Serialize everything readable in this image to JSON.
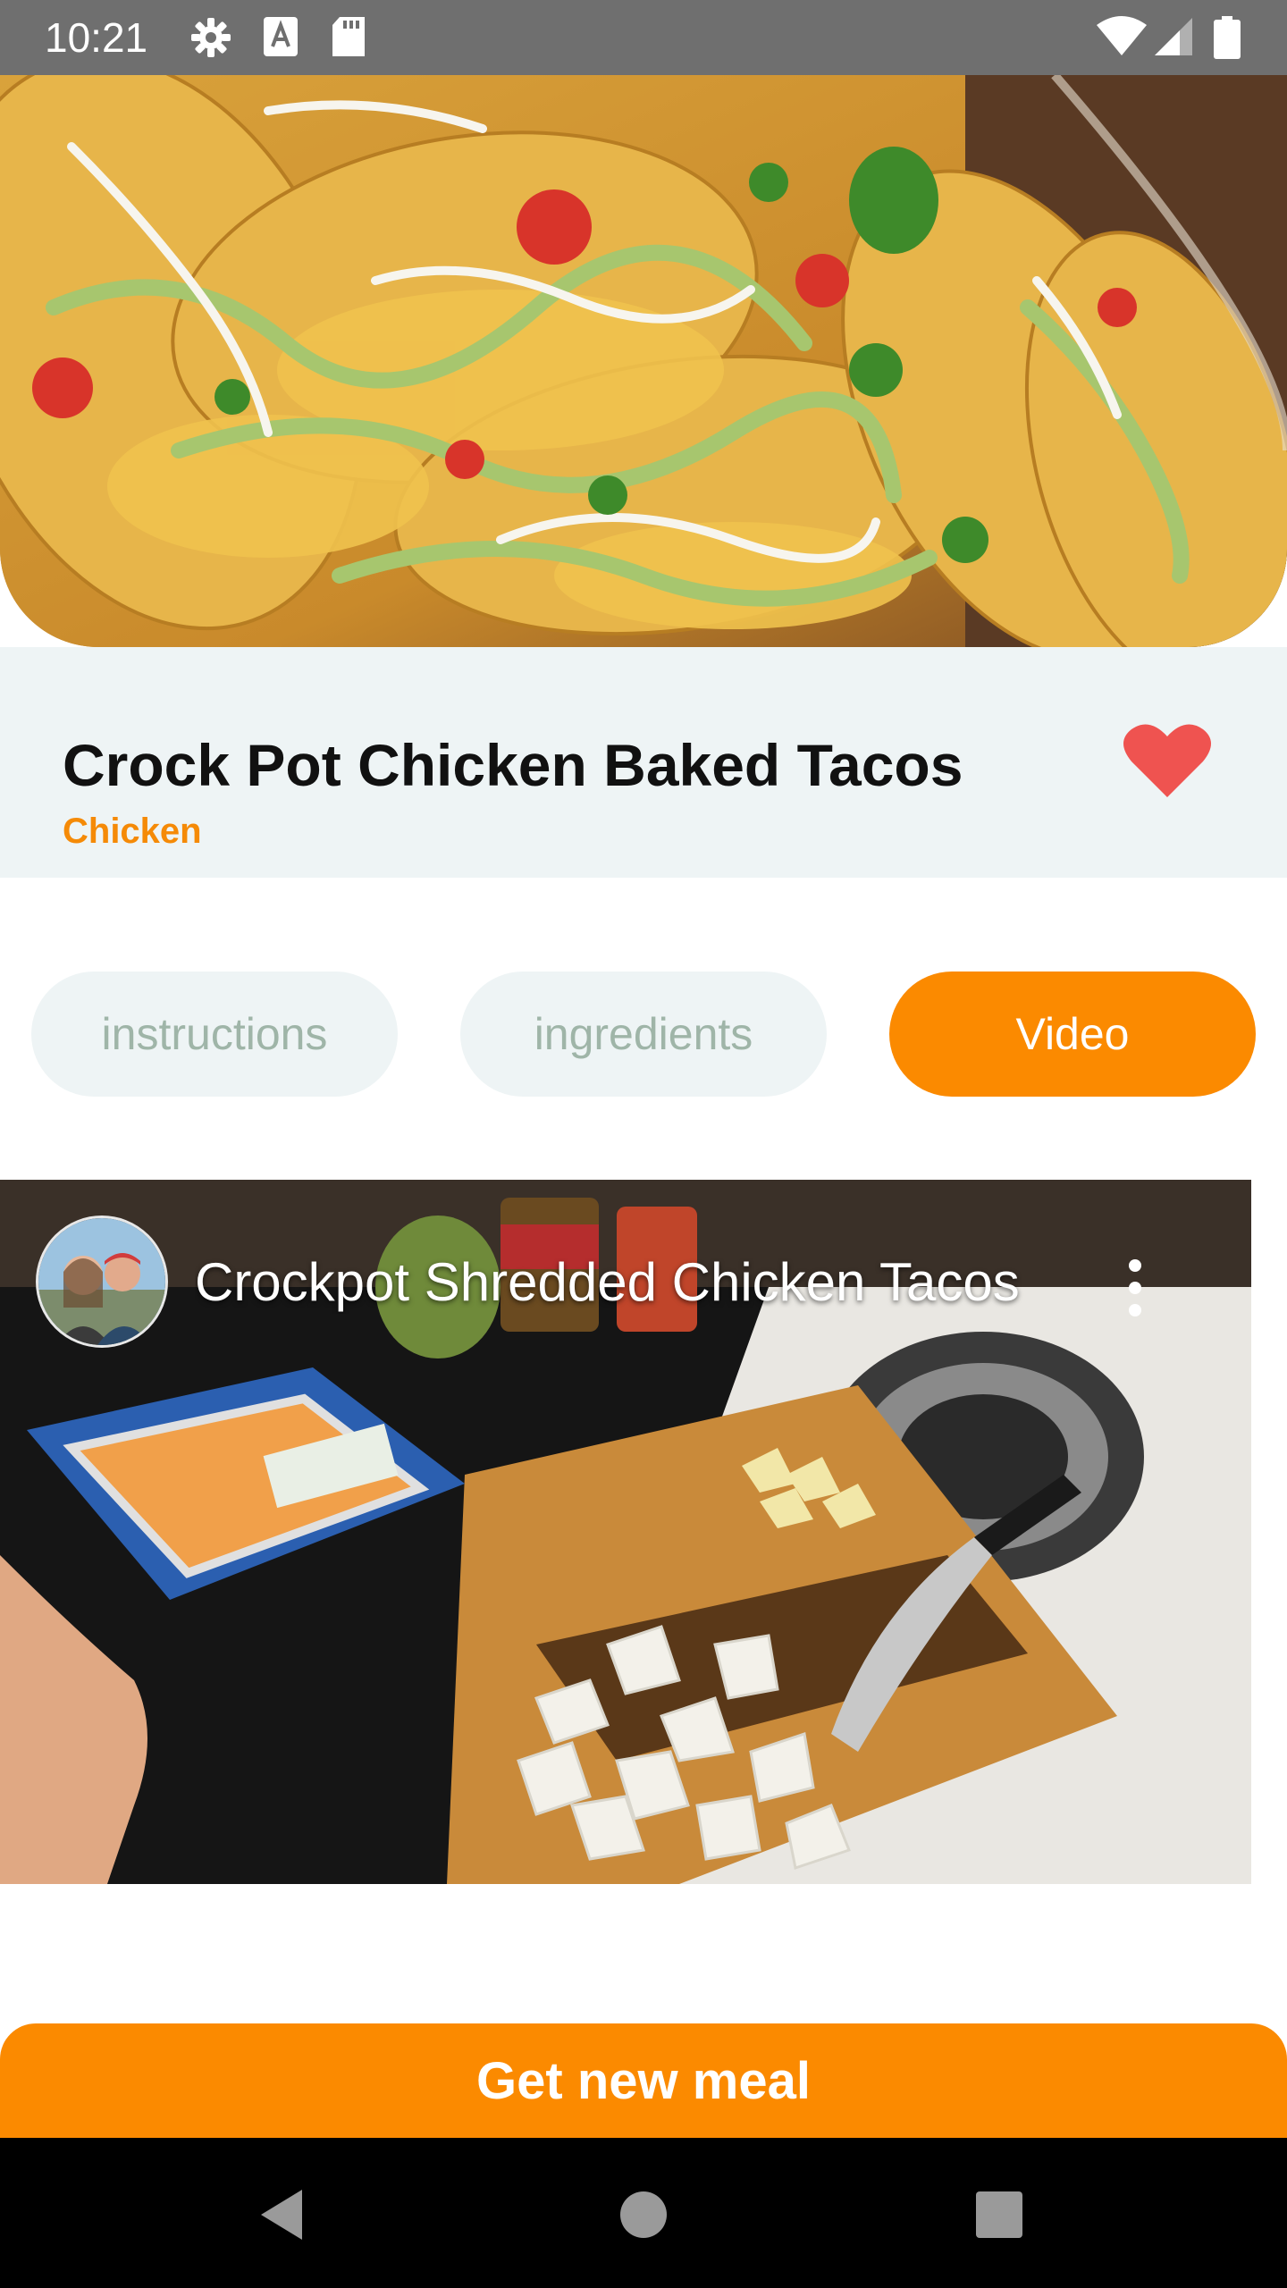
{
  "status_bar": {
    "time": "10:21",
    "left_icons": [
      "gear-icon",
      "font-a-icon",
      "sd-card-icon"
    ],
    "right_icons": [
      "wifi-icon",
      "cell-signal-icon",
      "battery-icon"
    ]
  },
  "meal": {
    "title": "Crock Pot Chicken Baked Tacos",
    "category": "Chicken",
    "favorite": true,
    "favorite_color": "#ef5350"
  },
  "tabs": [
    {
      "label": "instructions",
      "active": false
    },
    {
      "label": "ingredients",
      "active": false
    },
    {
      "label": "Video",
      "active": true
    }
  ],
  "video": {
    "title": "Crockpot Shredded Chicken Tacos",
    "menu_icon": "more-vertical-icon"
  },
  "cta": {
    "label": "Get new meal"
  },
  "nav_bar": {
    "icons": [
      "back-icon",
      "home-icon",
      "recents-icon"
    ]
  },
  "colors": {
    "accent": "#fb8a00",
    "header_bg": "#eef4f5",
    "inactive_tab_text": "#9fb5a8"
  }
}
